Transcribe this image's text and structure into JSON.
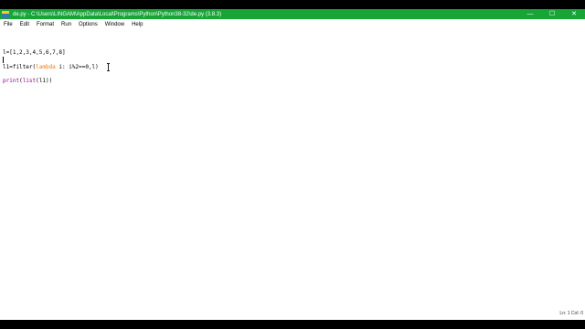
{
  "window": {
    "title": "de.py - C:\\Users\\LINGAM\\AppData\\Local\\Programs\\Python\\Python38-32\\de.py (3.8.3)",
    "controls": {
      "minimize": "—",
      "maximize": "☐",
      "close": "✕"
    },
    "title_color": "#17a538"
  },
  "menu": [
    "File",
    "Edit",
    "Format",
    "Run",
    "Options",
    "Window",
    "Help"
  ],
  "editor": {
    "line1": "l=[1,2,3,4,5,6,7,8]",
    "line2_pre": "l1=filter(",
    "line2_kw": "lambda",
    "line2_post": " i: i%2==0,l)",
    "line3_bi": "print",
    "line3_pre": "(",
    "line3_bi2": "list",
    "line3_post": "(l1))",
    "colors": {
      "keyword": "#ff7700",
      "builtin": "#900090"
    }
  },
  "status": {
    "position": "Ln: 1  Col: 0"
  }
}
